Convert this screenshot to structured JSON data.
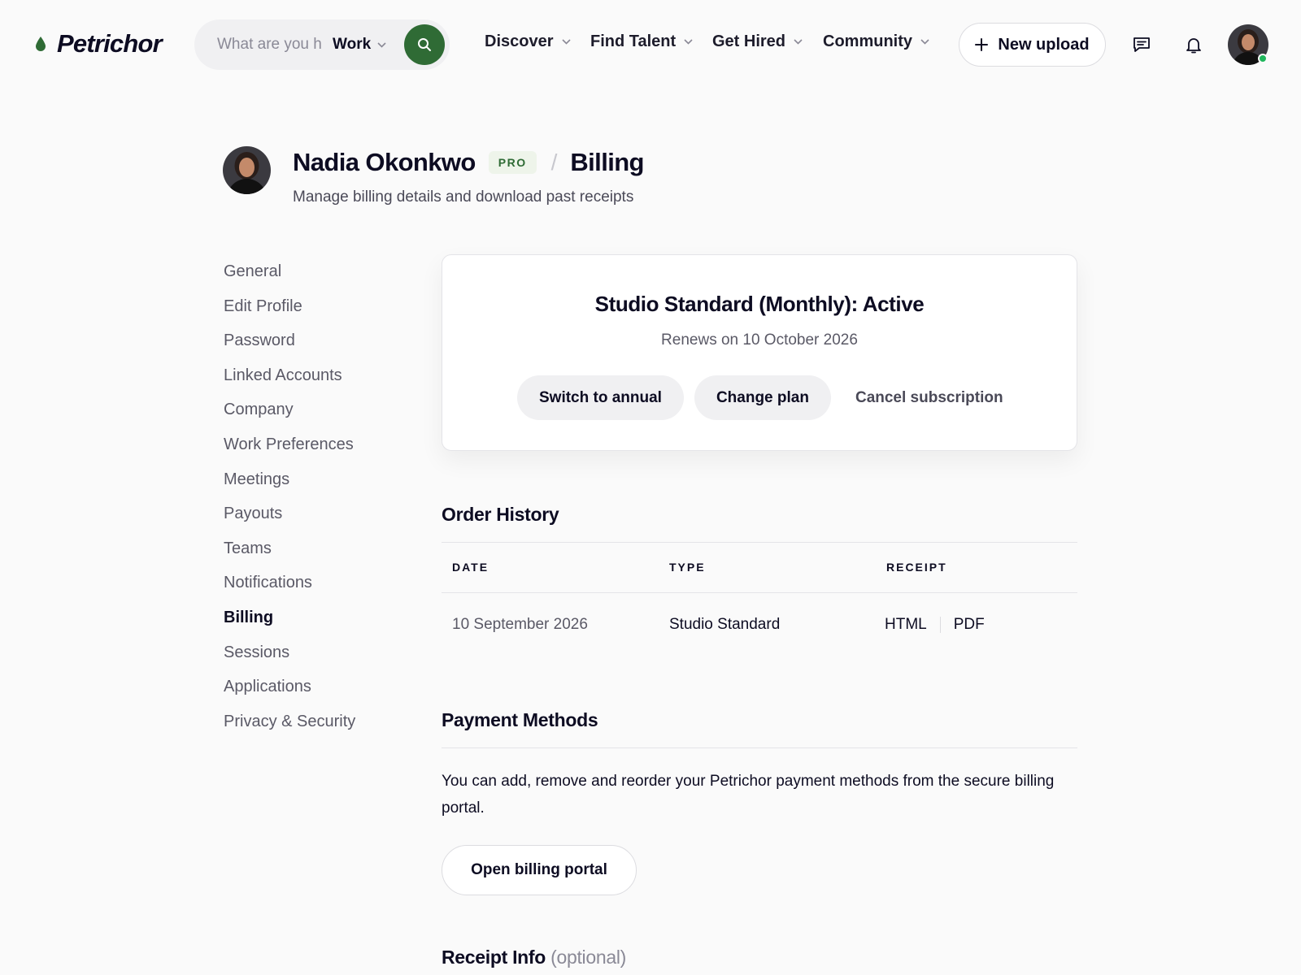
{
  "header": {
    "logo": "Petrichor",
    "search": {
      "placeholder": "What are you h",
      "scope": "Work"
    },
    "nav": [
      {
        "label": "Discover"
      },
      {
        "label": "Find Talent"
      },
      {
        "label": "Get Hired"
      },
      {
        "label": "Community"
      }
    ],
    "upload_label": "New upload",
    "icons": [
      "logo-drop-icon",
      "search-icon",
      "chevron-down-icon",
      "plus-icon",
      "message-icon",
      "bell-icon"
    ],
    "online_status_color": "#1fb65b"
  },
  "profile": {
    "name": "Nadia Okonkwo",
    "badge": "PRO",
    "separator": "/",
    "section": "Billing",
    "subtitle": "Manage billing details and download past receipts"
  },
  "sidenav": {
    "items": [
      "General",
      "Edit Profile",
      "Password",
      "Linked Accounts",
      "Company",
      "Work Preferences",
      "Meetings",
      "Payouts",
      "Teams",
      "Notifications",
      "Billing",
      "Sessions",
      "Applications",
      "Privacy & Security"
    ],
    "active": "Billing"
  },
  "plan": {
    "title": "Studio Standard (Monthly): Active",
    "renews": "Renews on 10 October 2026",
    "actions": {
      "switch": "Switch to annual",
      "change": "Change plan",
      "cancel": "Cancel subscription"
    }
  },
  "order_history": {
    "title": "Order History",
    "columns": [
      "DATE",
      "TYPE",
      "RECEIPT"
    ],
    "rows": [
      {
        "date": "10 September 2026",
        "type": "Studio Standard",
        "receipt": [
          "HTML",
          "PDF"
        ]
      }
    ]
  },
  "payment_methods": {
    "title": "Payment Methods",
    "text": "You can add, remove and reorder your Petrichor payment methods from the secure billing portal.",
    "button": "Open billing portal"
  },
  "receipt_info": {
    "title": "Receipt Info",
    "optional": "(optional)"
  },
  "colors": {
    "brand": "#2f6b35",
    "badge_bg": "#eef4ea",
    "text": "#0d0c22",
    "muted": "#5a5966"
  }
}
